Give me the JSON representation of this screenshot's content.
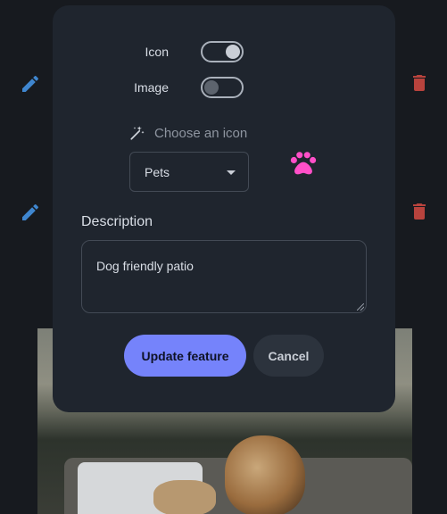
{
  "dialog": {
    "toggles": [
      {
        "label": "Icon",
        "state": "on"
      },
      {
        "label": "Image",
        "state": "off"
      }
    ],
    "choose_icon_label": "Choose an icon",
    "icon_select_value": "Pets",
    "selected_icon": "paw-icon",
    "description_label": "Description",
    "description_value": "Dog friendly patio",
    "update_button": "Update feature",
    "cancel_button": "Cancel"
  },
  "background": {
    "row_actions": [
      "edit-icon",
      "delete-icon"
    ],
    "photo": "corgi-on-patio-photo"
  },
  "colors": {
    "modal_bg": "#1f252e",
    "page_bg": "#171a1f",
    "accent": "#7583fb",
    "edit_icon": "#3f86cf",
    "delete_icon": "#b8433d",
    "paw_icon": "#ff4fc8"
  }
}
